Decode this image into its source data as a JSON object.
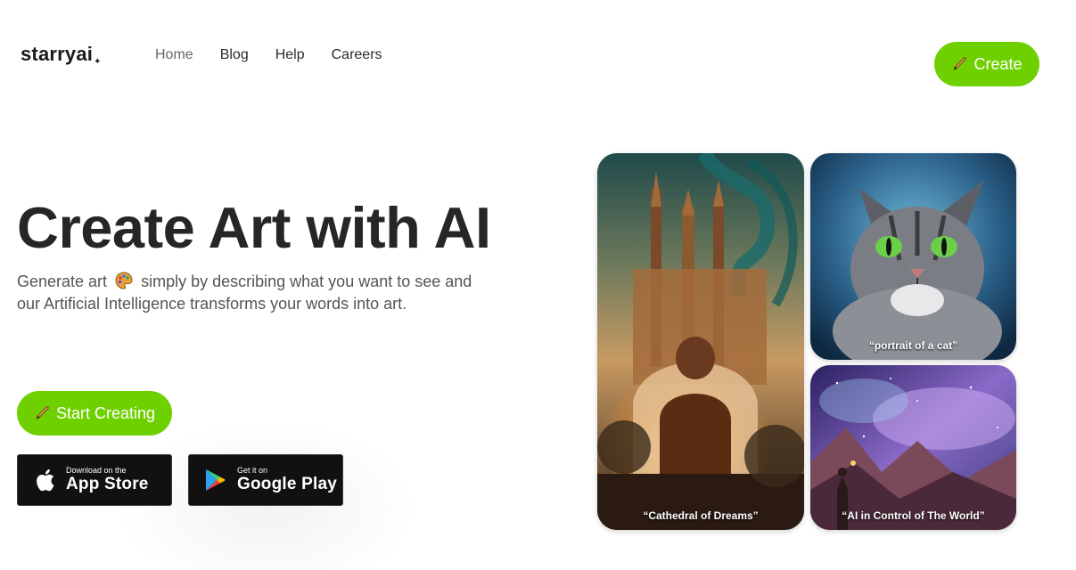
{
  "header": {
    "logo": "starryai",
    "logo_star": "✦",
    "nav": [
      "Home",
      "Blog",
      "Help",
      "Careers"
    ],
    "active_nav": "Home",
    "create_label": "Create"
  },
  "hero": {
    "title": "Create Art with AI",
    "subtitle_before_emoji": "Generate art",
    "subtitle_after_emoji": "simply by describing what you want to see and our Artificial Intelligence transforms your words into art.",
    "start_label": "Start Creating"
  },
  "stores": {
    "apple": {
      "small": "Download on the",
      "big": "App Store"
    },
    "google": {
      "small": "Get it on",
      "big": "Google Play"
    }
  },
  "gallery": {
    "cathedral_caption": "“Cathedral of Dreams”",
    "cat_caption": "“portrait of a cat”",
    "space_caption": "“AI in Control of The World”"
  },
  "colors": {
    "accent": "#6fd000",
    "text": "#262626",
    "badge_bg": "#111111"
  },
  "icons": [
    "brush-icon",
    "palette-icon",
    "apple-icon",
    "google-play-icon"
  ]
}
